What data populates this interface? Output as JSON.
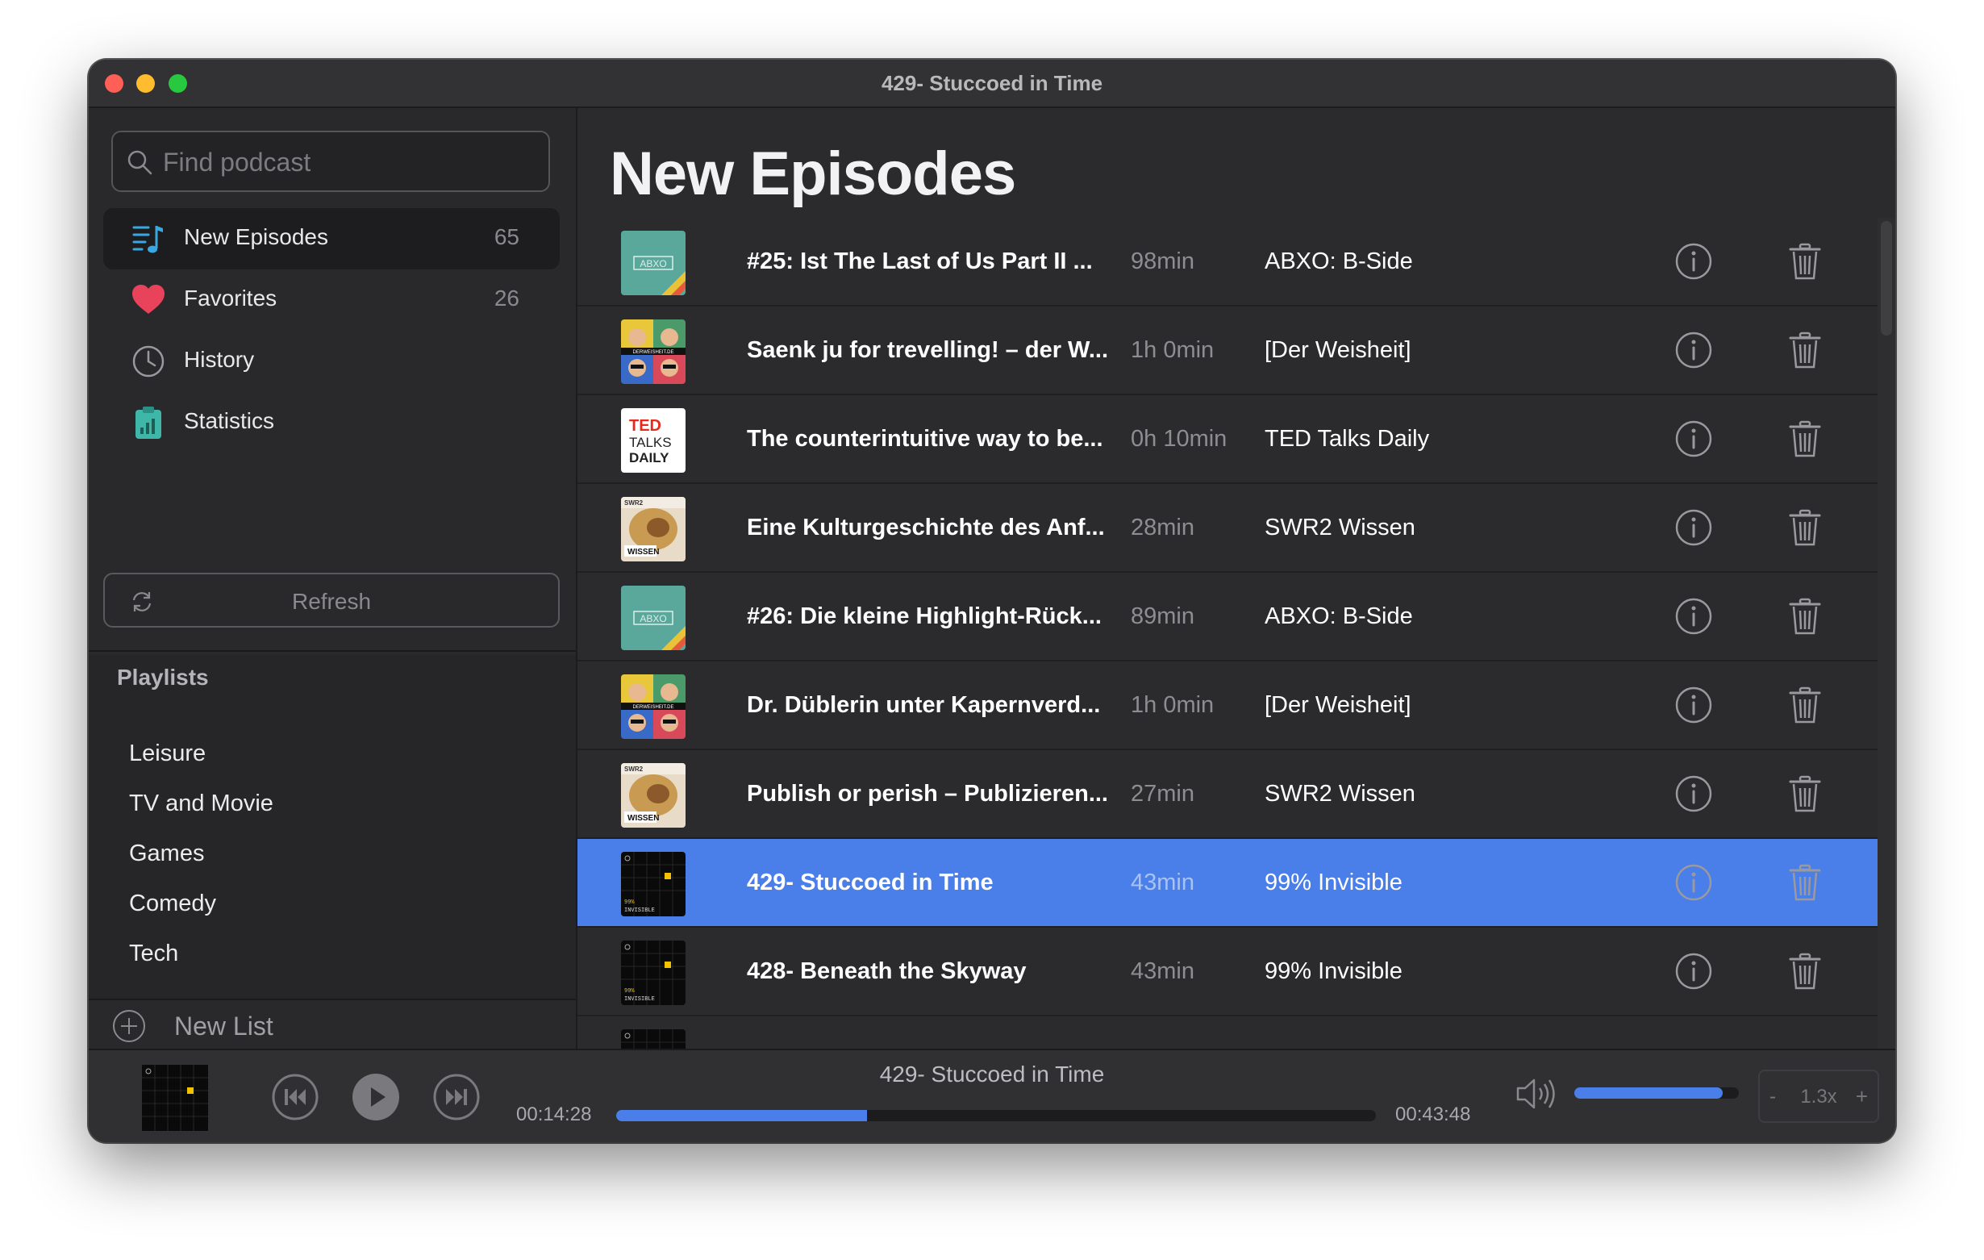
{
  "window": {
    "title": "429- Stuccoed in Time"
  },
  "sidebar": {
    "search_placeholder": "Find podcast",
    "nav": [
      {
        "label": "New Episodes",
        "count": "65",
        "icon": "new-episodes-icon"
      },
      {
        "label": "Favorites",
        "count": "26",
        "icon": "heart-icon"
      },
      {
        "label": "History",
        "count": "",
        "icon": "clock-icon"
      },
      {
        "label": "Statistics",
        "count": "",
        "icon": "statistics-icon"
      }
    ],
    "refresh_label": "Refresh",
    "playlists_header": "Playlists",
    "playlists": [
      "Leisure",
      "TV and Movie",
      "Games",
      "Comedy",
      "Tech"
    ],
    "new_list_label": "New List"
  },
  "main": {
    "title": "New Episodes",
    "episodes": [
      {
        "title": "#25: Ist The Last of Us Part II ...",
        "duration": "98min",
        "show": "ABXO: B-Side",
        "art": "abxo",
        "selected": false
      },
      {
        "title": "Saenk ju for trevelling! – der W...",
        "duration": "1h 0min",
        "show": "[Der Weisheit]",
        "art": "weisheit",
        "selected": false
      },
      {
        "title": "The counterintuitive way to be...",
        "duration": "0h 10min",
        "show": "TED Talks Daily",
        "art": "ted",
        "selected": false
      },
      {
        "title": "Eine Kulturgeschichte des Anf...",
        "duration": "28min",
        "show": "SWR2 Wissen",
        "art": "swr2",
        "selected": false
      },
      {
        "title": "#26: Die kleine Highlight-Rück...",
        "duration": "89min",
        "show": "ABXO: B-Side",
        "art": "abxo",
        "selected": false
      },
      {
        "title": "Dr. Düblerin unter Kapernverd...",
        "duration": "1h 0min",
        "show": "[Der Weisheit]",
        "art": "weisheit",
        "selected": false
      },
      {
        "title": "Publish or perish – Publizieren...",
        "duration": "27min",
        "show": "SWR2 Wissen",
        "art": "swr2",
        "selected": false
      },
      {
        "title": "429- Stuccoed in Time",
        "duration": "43min",
        "show": "99% Invisible",
        "art": "invisible",
        "selected": true
      },
      {
        "title": "428- Beneath the Skyway",
        "duration": "43min",
        "show": "99% Invisible",
        "art": "invisible",
        "selected": false
      }
    ]
  },
  "player": {
    "title": "429- Stuccoed in Time",
    "elapsed": "00:14:28",
    "total": "00:43:48",
    "progress": 0.33,
    "volume": 0.9,
    "speed": "1.3x",
    "speed_minus": "-",
    "speed_plus": "+"
  },
  "art_labels": {
    "abxo": "ABXO",
    "ted_line1": "TED",
    "ted_line2": "TALKS",
    "ted_line3": "DAILY",
    "swr2_top": "SWR2",
    "swr2_bottom": "WISSEN",
    "invisible_top": "99%",
    "invisible_bottom": "INVISIBLE",
    "weisheit": "DERWEISHEIT.DE"
  },
  "colors": {
    "accent": "#4a7ee8",
    "heart": "#e8435a",
    "nav_icon": "#3aa8e0",
    "stats_icon": "#3fb7a8"
  }
}
